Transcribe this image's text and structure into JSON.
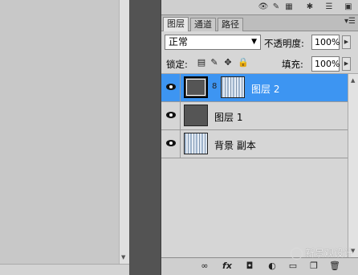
{
  "top_toolbar": {
    "icons": [
      "eye-brush-icon",
      "swatch-icon",
      "adjust-icon",
      "spark-icon",
      "list-icon",
      "grid-icon"
    ]
  },
  "tabs": [
    {
      "label": "图层",
      "active": true
    },
    {
      "label": "通道",
      "active": false
    },
    {
      "label": "路径",
      "active": false
    }
  ],
  "options": {
    "blend_mode": "正常",
    "opacity_label": "不透明度:",
    "opacity_value": "100%",
    "lock_label": "锁定:",
    "fill_label": "填充:",
    "fill_value": "100%"
  },
  "layers": [
    {
      "name": "图层 2",
      "selected": true,
      "has_mask": true
    },
    {
      "name": "图层 1",
      "selected": false,
      "has_mask": false
    },
    {
      "name": "背景 副本",
      "selected": false,
      "has_mask": false
    }
  ],
  "bottom_bar": {
    "icons": [
      "link-icon",
      "fx-icon",
      "mask-icon",
      "adjustment-layer-icon",
      "group-icon",
      "new-layer-icon",
      "trash-icon"
    ]
  },
  "watermark": "新景观设计",
  "colors": {
    "selection": "#3d95f2",
    "panel_bg": "#d6d6d6",
    "workspace": "#535353"
  }
}
